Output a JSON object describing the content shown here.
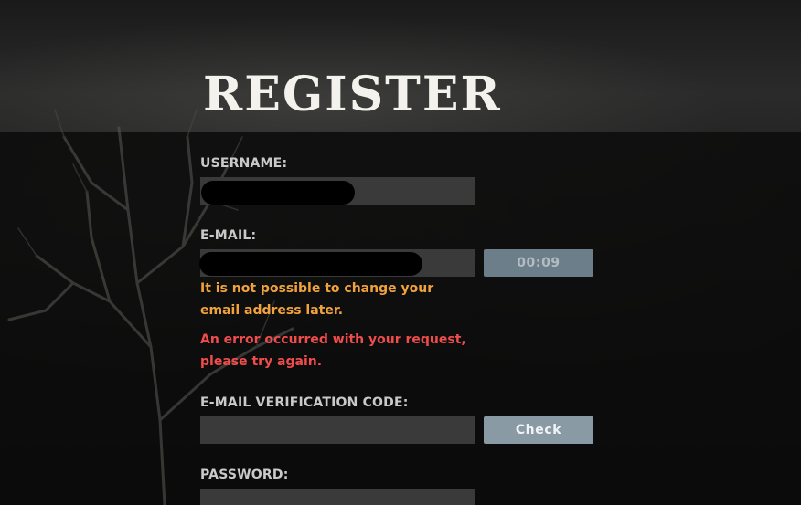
{
  "header": {
    "title": "REGISTER"
  },
  "form": {
    "username": {
      "label": "USERNAME:",
      "value": ""
    },
    "email": {
      "label": "E-MAIL:",
      "value": "",
      "timer_label": "00:09",
      "note": "It is not possible to change your email address later.",
      "error": "An error occurred with your request, please try again."
    },
    "verification": {
      "label": "E-MAIL VERIFICATION CODE:",
      "value": "",
      "button_label": "Check"
    },
    "password": {
      "label": "PASSWORD:",
      "value": ""
    }
  },
  "colors": {
    "warning": "#f0a23c",
    "error": "#f04c4c",
    "button": "#8a9aa4"
  }
}
